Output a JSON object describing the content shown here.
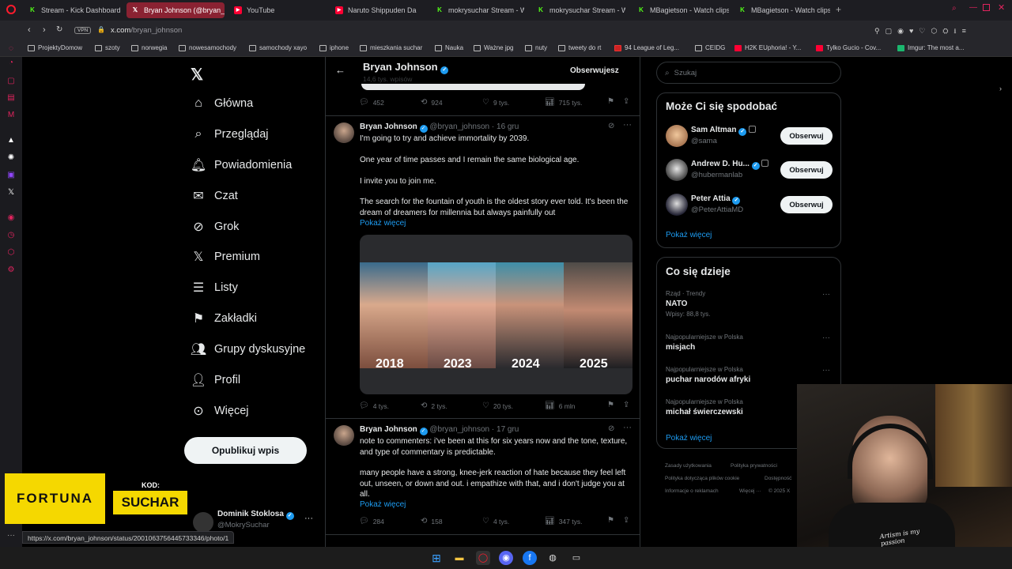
{
  "browser": {
    "tabs": [
      {
        "label": "Stream - Kick Dashboard",
        "icon": "kick-icon"
      },
      {
        "label": "Bryan Johnson (@bryan_",
        "icon": "x-icon",
        "active": true
      },
      {
        "label": "YouTube",
        "icon": "youtube-icon"
      },
      {
        "label": "Naruto Shippuden Da",
        "icon": "youtube-icon"
      },
      {
        "label": "mokrysuchar Stream - W",
        "icon": "kick-icon"
      },
      {
        "label": "mokrysuchar Stream - W",
        "icon": "kick-icon"
      },
      {
        "label": "MBagietson - Watch clips",
        "icon": "kick-icon"
      },
      {
        "label": "MBagietson - Watch clips",
        "icon": "kick-icon"
      }
    ],
    "vpn_label": "VPN",
    "url_host": "x.com",
    "url_path": "/bryan_johnson",
    "bookmarks": [
      "ProjektyDomow",
      "szoty",
      "norwegia",
      "nowesamochody",
      "samochody xayo",
      "iphone",
      "mieszkania suchar",
      "Nauka",
      "Ważne jpg",
      "nuty",
      "tweety do rt",
      "94 League of Leg...",
      "CEIDG",
      "H2K EUphoria! - Y...",
      "Tylko Gucio - Cov...",
      "Imgur: The most a..."
    ],
    "status_url": "https://x.com/bryan_johnson/status/2001063756445733346/photo/1"
  },
  "nav": {
    "items": [
      "Główna",
      "Przeglądaj",
      "Powiadomienia",
      "Czat",
      "Grok",
      "Premium",
      "Listy",
      "Zakładki",
      "Grupy dyskusyjne",
      "Profil",
      "Więcej"
    ],
    "post_button": "Opublikuj wpis"
  },
  "profile_header": {
    "name": "Bryan Johnson",
    "posts_count": "14,6 tys. wpisów",
    "following_button": "Obserwujesz"
  },
  "top_tweet_actions": {
    "replies": "452",
    "retweets": "924",
    "likes": "9 tys.",
    "views": "715 tys."
  },
  "tweets": [
    {
      "name": "Bryan Johnson",
      "handle": "@bryan_johnson",
      "date": "· 16 gru",
      "lines": [
        "I'm going to try and achieve immortality by 2039.",
        "One year of time passes and I remain the same biological age.",
        "I invite you to join me.",
        "The search for the fountain of youth is the oldest story ever told. It's been the dream of dreamers for millennia but always painfully out"
      ],
      "show_more": "Pokaż więcej",
      "image_years": [
        "2018",
        "2023",
        "2024",
        "2025"
      ],
      "replies": "4 tys.",
      "retweets": "2 tys.",
      "likes": "20 tys.",
      "views": "6 mln"
    },
    {
      "name": "Bryan Johnson",
      "handle": "@bryan_johnson",
      "date": "· 17 gru",
      "lines": [
        "note to commenters: i've been at this for six years now and the tone, texture, and type of commentary is predictable.",
        "many people have a strong, knee-jerk reaction of hate because they feel left out, unseen, or down and out. i empathize with that, and i don't judge you at all."
      ],
      "show_more": "Pokaż więcej",
      "replies": "284",
      "retweets": "158",
      "likes": "4 tys.",
      "views": "347 tys."
    }
  ],
  "search": {
    "placeholder": "Szukaj"
  },
  "who_to_follow": {
    "title": "Może Ci się spodobać",
    "users": [
      {
        "name": "Sam Altman",
        "handle": "@sama"
      },
      {
        "name": "Andrew D. Hu...",
        "handle": "@hubermanlab"
      },
      {
        "name": "Peter Attia",
        "handle": "@PeterAttiaMD"
      }
    ],
    "follow_label": "Obserwuj",
    "show_more": "Pokaż więcej"
  },
  "trends": {
    "title": "Co się dzieje",
    "items": [
      {
        "context": "Rząd · Trendy",
        "topic": "NATO",
        "count": "Wpisy: 88,8 tys."
      },
      {
        "context": "Najpopularniejsze w Polska",
        "topic": "misjach"
      },
      {
        "context": "Najpopularniejsze w Polska",
        "topic": "puchar narodów afryki"
      },
      {
        "context": "Najpopularniejsze w Polska",
        "topic": "michał świerczewski"
      }
    ],
    "show_more": "Pokaż więcej"
  },
  "footer": {
    "links": [
      "Zasady użytkowania",
      "Polityka prywatności",
      "Polityka dotycząca plików cookie",
      "Dostępność",
      "Informacje o reklamach",
      "Więcej ···",
      "© 2025 X"
    ]
  },
  "account": {
    "name": "Dominik Stoklosa",
    "handle": "@MokrySuchar"
  },
  "overlay": {
    "brand": "FORTUNA",
    "code_label": "KOD:",
    "code": "SUCHAR"
  },
  "webcam": {
    "shirt_text": "Artism is my passion"
  },
  "colors": {
    "accent": "#1d9bf0",
    "active_tab": "#8a2232",
    "fortuna_yellow": "#f5d800"
  }
}
